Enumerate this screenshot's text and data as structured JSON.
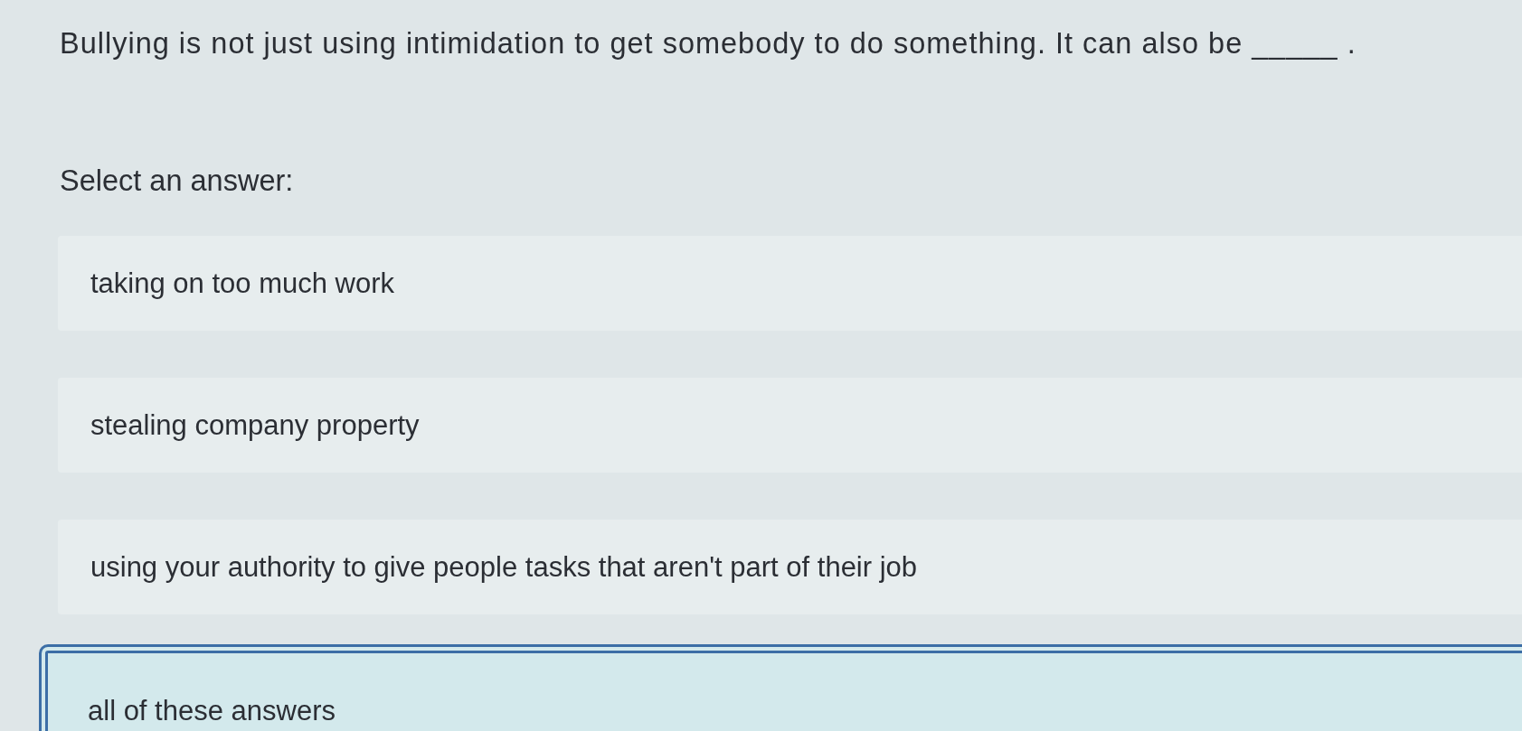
{
  "question": {
    "text": "Bullying is not just using intimidation to get somebody to do something. It can also be _____ ."
  },
  "prompt": "Select an answer:",
  "options": [
    {
      "label": "taking on too much work",
      "selected": false
    },
    {
      "label": "stealing company property",
      "selected": false
    },
    {
      "label": "using your authority to give people tasks that aren't part of their job",
      "selected": false
    },
    {
      "label": "all of these answers",
      "selected": true
    }
  ]
}
